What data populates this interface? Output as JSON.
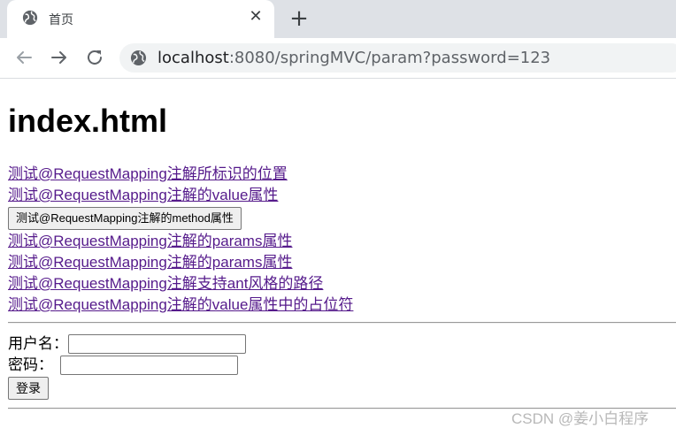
{
  "browser": {
    "tab_title": "首页",
    "url_host": "localhost",
    "url_rest": ":8080/springMVC/param?password=123"
  },
  "page": {
    "heading": "index.html",
    "links": [
      "测试@RequestMapping注解所标识的位置",
      "测试@RequestMapping注解的value属性"
    ],
    "method_button": "测试@RequestMapping注解的method属性",
    "links2": [
      "测试@RequestMapping注解的params属性",
      "测试@RequestMapping注解的params属性",
      "测试@RequestMapping注解支持ant风格的路径",
      "测试@RequestMapping注解的value属性中的占位符"
    ],
    "form": {
      "username_label": "用户名：",
      "username_value": "",
      "password_label": "密码：",
      "password_value": "",
      "submit_label": "登录"
    }
  },
  "watermark": "CSDN @姜小白程序",
  "colors": {
    "link_visited": "#551a8b",
    "tabstrip": "#dee1e6",
    "omnibox": "#f1f3f4"
  }
}
